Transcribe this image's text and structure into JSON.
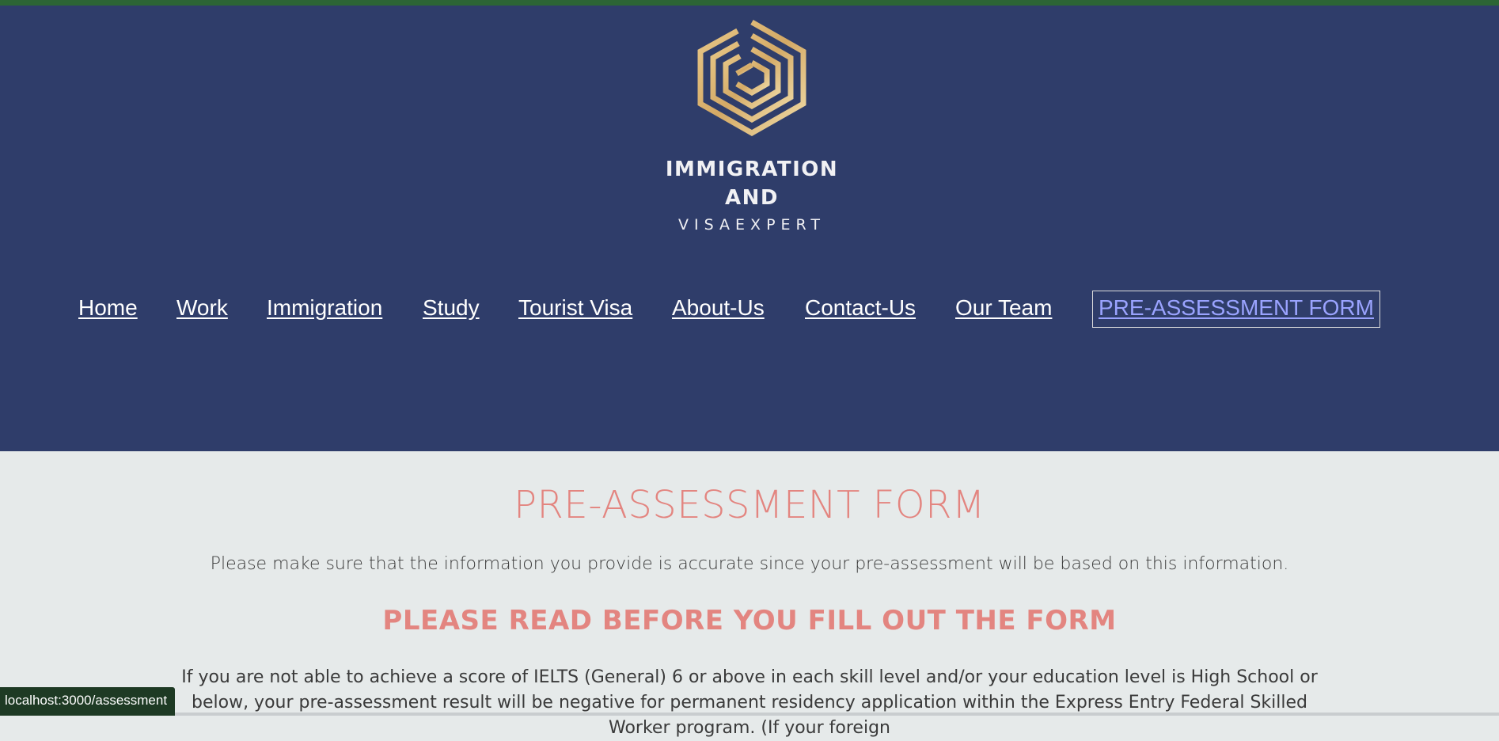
{
  "brand": {
    "line1": "IMMIGRATION",
    "line2": "AND",
    "line3": "VISAEXPERT",
    "logo_icon": "geometric-hexagon-logo",
    "gold_color": "#d4a965",
    "light_gold_color": "#efd7a3"
  },
  "nav": {
    "items": [
      {
        "label": "Home"
      },
      {
        "label": "Work"
      },
      {
        "label": "Immigration"
      },
      {
        "label": "Study"
      },
      {
        "label": "Tourist Visa"
      },
      {
        "label": "About-Us"
      },
      {
        "label": "Contact-Us"
      },
      {
        "label": "Our Team"
      },
      {
        "label": "PRE-ASSESSMENT FORM",
        "active": true
      }
    ],
    "active_color": "#9aa3ff"
  },
  "main": {
    "title": "PRE-ASSESSMENT FORM",
    "intro": "Please make sure that the information you provide is accurate since your pre-assessment will be based on this information.",
    "subtitle": "PLEASE READ BEFORE YOU FILL OUT THE FORM",
    "notice": "If you are not able to achieve a score of IELTS (General) 6 or above in each skill level and/or your education level is High School or below, your pre-assessment result will be negative for permanent residency application within the Express Entry Federal Skilled Worker program. (If your foreign"
  },
  "status_bar": {
    "url": "localhost:3000/assessment"
  },
  "colors": {
    "header_bg": "#2f3d6a",
    "content_bg": "#e6eaea",
    "accent_salmon": "#e38580",
    "top_line": "#2c6535"
  }
}
